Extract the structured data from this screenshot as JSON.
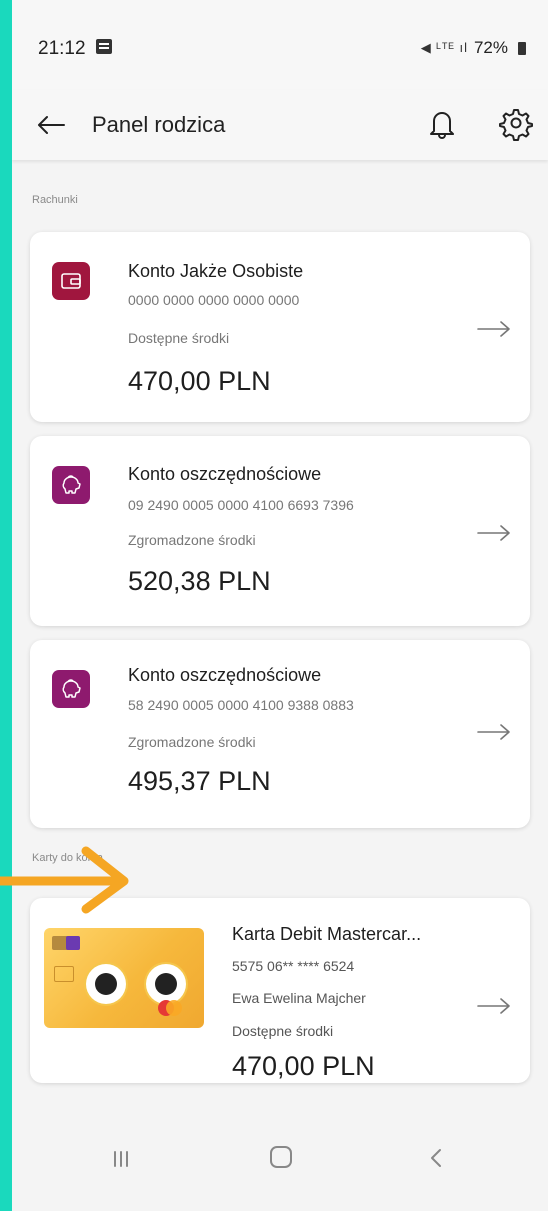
{
  "status": {
    "time": "21:12",
    "signal": "◀ ᴸᵀᴱ ıl",
    "battery": "72%"
  },
  "header": {
    "title": "Panel rodzica"
  },
  "sections": {
    "accounts": "Rachunki",
    "cards": "Karty do konta"
  },
  "accounts": [
    {
      "name": "Konto Jakże Osobiste",
      "number": "0000 0000 0000 0000 0000",
      "label": "Dostępne środki",
      "amount": "470,00 PLN",
      "icon": "wallet-icon",
      "color": "#a0163e"
    },
    {
      "name": "Konto oszczędnościowe",
      "number": "09 2490 0005 0000 4100 6693 7396",
      "label": "Zgromadzone środki",
      "amount": "520,38 PLN",
      "icon": "piggy-bank-icon",
      "color": "#8e1a6e"
    },
    {
      "name": "Konto oszczędnościowe",
      "number": "58 2490 0005 0000 4100 9388 0883",
      "label": "Zgromadzone środki",
      "amount": "495,37 PLN",
      "icon": "piggy-bank-icon",
      "color": "#8e1a6e"
    }
  ],
  "card": {
    "name": "Karta Debit Mastercar...",
    "number": "5575 06** **** 6524",
    "holder": "Ewa Ewelina Majcher",
    "label": "Dostępne środki",
    "amount": "470,00 PLN"
  },
  "colors": {
    "frame": "#1ad9bd",
    "annotation": "#f5a623"
  }
}
